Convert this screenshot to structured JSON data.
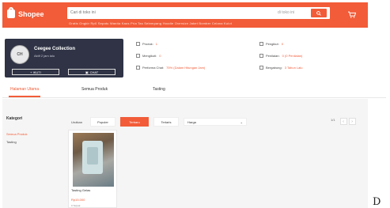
{
  "header": {
    "brand": "Shopee",
    "search_placeholder": "Cari di toko ini",
    "search_scope": "di toko ini",
    "hotwords": "Gratis Ongkir Rp0  Sepatu Wanita  Kaos Pria  Tas Selempang  Hoodie Oversize  Jaket Bomber  Celana Kulot"
  },
  "shop": {
    "avatar_text": "CH",
    "name": "Ceegee Collection",
    "status": "Aktif 2 jam lalu",
    "follow_label": "+ IKUTI",
    "chat_label": "CHAT"
  },
  "stats": {
    "col1": [
      {
        "label": "Produk:",
        "value": "1"
      },
      {
        "label": "Mengikuti:",
        "value": "0"
      },
      {
        "label": "Performa Chat:",
        "value": "75% (Dalam Hitungan Jam)"
      }
    ],
    "col2": [
      {
        "label": "Pengikut:",
        "value": "0"
      },
      {
        "label": "Penilaian:",
        "value": "0 (0 Penilaian)"
      },
      {
        "label": "Bergabung:",
        "value": "3 Tahun Lalu"
      }
    ]
  },
  "tabs": [
    "Halaman Utama",
    "Semua Produk",
    "Tasting"
  ],
  "categories": {
    "title": "Kategori",
    "items": [
      "Semua Produk",
      "Tasting"
    ]
  },
  "sortbar": {
    "label": "Urutkan",
    "options": [
      "Populer",
      "Terbaru",
      "Terlaris"
    ],
    "price_label": "Harga",
    "page": "1/1"
  },
  "product": {
    "name": "Tasting Gelas",
    "price": "Rp15.000",
    "sold": "0 Terjual"
  },
  "colors": {
    "brand": "#f25c38",
    "card": "#2f3345"
  },
  "corner_text": "D"
}
